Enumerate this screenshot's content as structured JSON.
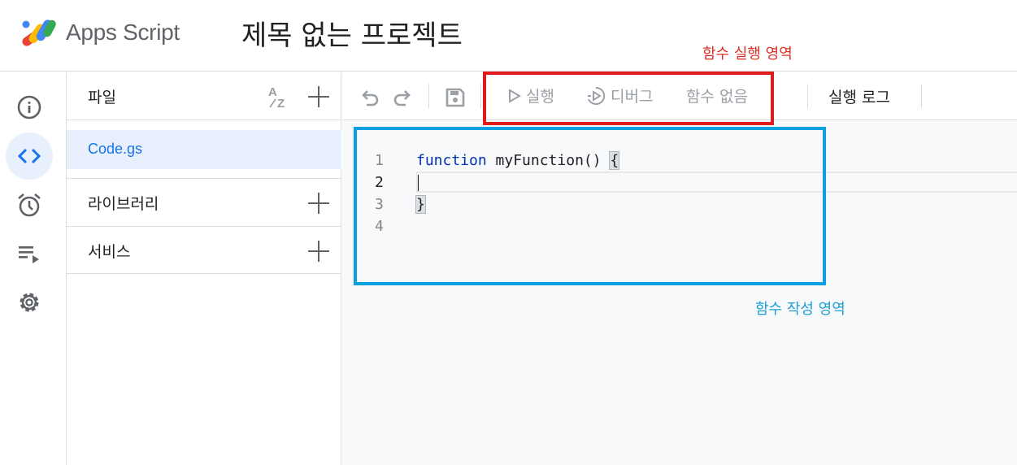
{
  "header": {
    "app_name": "Apps Script",
    "project_title": "제목 없는 프로젝트",
    "logo_icon": "apps-script-logo"
  },
  "annotations": {
    "run_area": "함수 실행 영역",
    "write_area": "함수 작성 영역",
    "run_color": "#d93025",
    "write_color": "#0ba1e0"
  },
  "rail": {
    "items": [
      {
        "name": "overview",
        "icon": "info-icon"
      },
      {
        "name": "editor",
        "icon": "code-icon",
        "active": true
      },
      {
        "name": "triggers",
        "icon": "alarm-clock-icon"
      },
      {
        "name": "executions",
        "icon": "list-play-icon"
      },
      {
        "name": "settings",
        "icon": "gear-icon"
      }
    ]
  },
  "files": {
    "label": "파일",
    "sort_icon": "sort-az-icon",
    "add_icon": "plus-icon",
    "items": [
      "Code.gs"
    ],
    "libraries_label": "라이브러리",
    "services_label": "서비스"
  },
  "toolbar": {
    "undo_icon": "undo-icon",
    "redo_icon": "redo-icon",
    "save_icon": "save-icon",
    "run_label": "실행",
    "debug_label": "디버그",
    "function_select": "함수 없음",
    "log_label": "실행 로그"
  },
  "editor": {
    "line_numbers": [
      "1",
      "2",
      "3",
      "4"
    ],
    "code": {
      "keyword": "function",
      "fn_name": " myFunction() ",
      "open_brace": "{",
      "close_brace": "}"
    }
  }
}
